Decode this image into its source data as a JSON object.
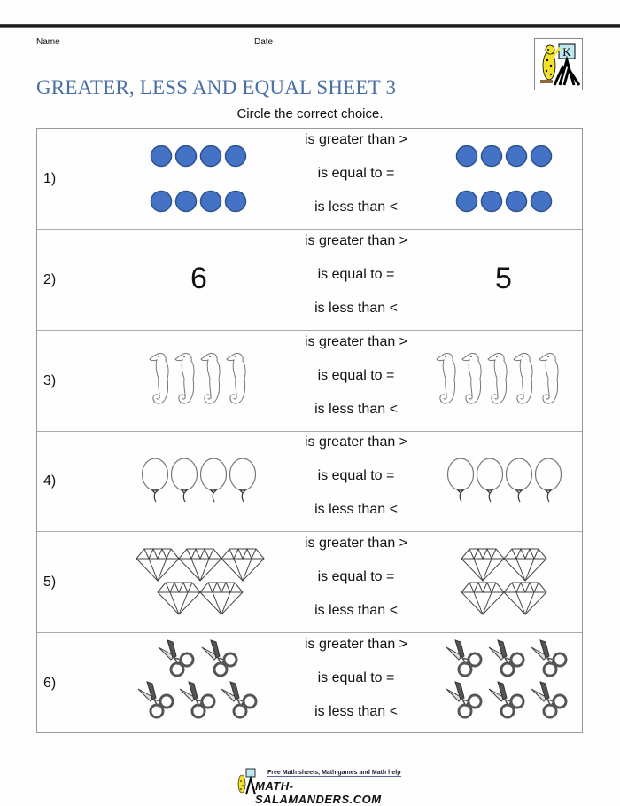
{
  "header": {
    "name_label": "Name",
    "date_label": "Date",
    "title": "GREATER, LESS AND EQUAL SHEET 3",
    "instruction": "Circle the correct choice.",
    "logo_letter": "K"
  },
  "choices": [
    "is greater than >",
    "is equal to =",
    "is less than <"
  ],
  "questions": [
    {
      "number": "1)",
      "left": {
        "type": "circle",
        "count": 8
      },
      "right": {
        "type": "circle",
        "count": 8
      }
    },
    {
      "number": "2)",
      "left": {
        "type": "number",
        "value": "6"
      },
      "right": {
        "type": "number",
        "value": "5"
      }
    },
    {
      "number": "3)",
      "left": {
        "type": "seahorse",
        "count": 4
      },
      "right": {
        "type": "seahorse",
        "count": 5
      }
    },
    {
      "number": "4)",
      "left": {
        "type": "balloon",
        "count": 4
      },
      "right": {
        "type": "balloon",
        "count": 4
      }
    },
    {
      "number": "5)",
      "left": {
        "type": "diamond",
        "count": 5
      },
      "right": {
        "type": "diamond",
        "count": 4
      }
    },
    {
      "number": "6)",
      "left": {
        "type": "scissors",
        "count": 5
      },
      "right": {
        "type": "scissors",
        "count": 6
      }
    }
  ],
  "colors": {
    "title": "#4a6fa5",
    "circle_fill": "#4472c4",
    "circle_stroke": "#2f528f"
  },
  "footer": {
    "tagline": "Free Math sheets, Math games and Math help",
    "brand": "MATH-SALAMANDERS.COM"
  }
}
